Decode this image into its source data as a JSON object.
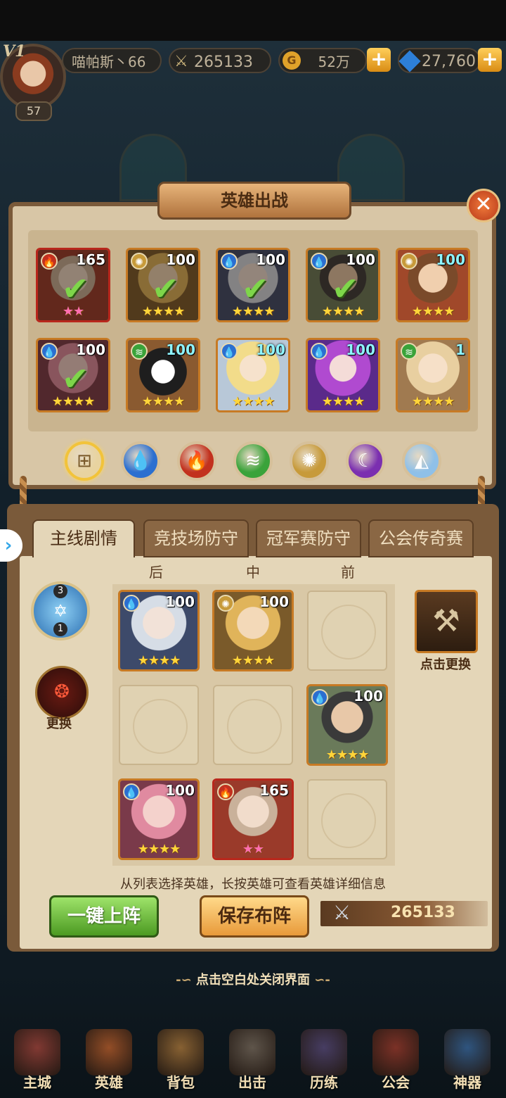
{
  "top_bar": {
    "vip_label": "V1",
    "player_level": "57",
    "player_name": "喵帕斯丶66",
    "combat_power": "265133",
    "gold": "52万",
    "gems": "27,760",
    "plus_symbol": "+",
    "coin_symbol": "G"
  },
  "panel_title": "英雄出战",
  "close_symbol": "✕",
  "hero_roster": [
    {
      "level": "165",
      "element": "fire",
      "stars": "★★",
      "star_color": "pink",
      "selected": true
    },
    {
      "level": "100",
      "element": "light",
      "stars": "★★★★",
      "selected": true
    },
    {
      "level": "100",
      "element": "water",
      "stars": "★★★★",
      "selected": true
    },
    {
      "level": "100",
      "element": "water",
      "stars": "★★★★",
      "selected": true
    },
    {
      "level": "100",
      "element": "light",
      "stars": "★★★★",
      "selected": false
    },
    {
      "level": "100",
      "element": "water",
      "stars": "★★★★",
      "selected": true
    },
    {
      "level": "100",
      "element": "wind",
      "stars": "★★★★",
      "selected": false
    },
    {
      "level": "100",
      "element": "water",
      "stars": "★★★★",
      "selected": false
    },
    {
      "level": "100",
      "element": "water",
      "stars": "★★★★",
      "selected": false
    },
    {
      "level": "1",
      "element": "wind",
      "stars": "★★★★",
      "selected": false
    }
  ],
  "check_symbol": "✔",
  "element_filters": [
    {
      "name": "all",
      "color": "#e8d3a0",
      "glyph": "⊞",
      "active": true
    },
    {
      "name": "water",
      "color": "#2b6fd0",
      "glyph": "💧",
      "active": false
    },
    {
      "name": "fire",
      "color": "#c2311e",
      "glyph": "🔥",
      "active": false
    },
    {
      "name": "wind",
      "color": "#3aa33a",
      "glyph": "≋",
      "active": false
    },
    {
      "name": "light",
      "color": "#c79a3a",
      "glyph": "✺",
      "active": false
    },
    {
      "name": "dark",
      "color": "#7b2fb0",
      "glyph": "☾",
      "active": false
    },
    {
      "name": "special",
      "color": "#8fc0e8",
      "glyph": "◭",
      "active": false
    }
  ],
  "tabs": [
    {
      "label": "主线剧情",
      "active": true
    },
    {
      "label": "竞技场防守",
      "active": false
    },
    {
      "label": "冠军赛防守",
      "active": false
    },
    {
      "label": "公会传奇赛",
      "active": false
    }
  ],
  "columns": {
    "back": "后",
    "middle": "中",
    "front": "前"
  },
  "formation": {
    "top_number": "3",
    "bottom_number": "1",
    "swap_label": "更换"
  },
  "artifact_label": "点击更换",
  "lineup": [
    {
      "level": "100",
      "element": "water",
      "stars": "★★★★"
    },
    {
      "level": "100",
      "element": "light",
      "stars": "★★★★"
    },
    {
      "level": "100",
      "element": "water",
      "stars": "★★★★"
    },
    {
      "level": "100",
      "element": "water",
      "stars": "★★★★"
    },
    {
      "level": "165",
      "element": "fire",
      "stars": "★★",
      "star_color": "pink"
    }
  ],
  "hint_text": "从列表选择英雄，长按英雄可查看英雄详细信息",
  "buttons": {
    "auto_deploy": "一键上阵",
    "save_lineup": "保存布阵"
  },
  "team_power": "265133",
  "close_hint": "点击空白处关闭界面",
  "close_hint_left": "-∽",
  "close_hint_right": "∽-",
  "bottom_nav": [
    {
      "label": "主城"
    },
    {
      "label": "英雄"
    },
    {
      "label": "背包"
    },
    {
      "label": "出击"
    },
    {
      "label": "历练"
    },
    {
      "label": "公会"
    },
    {
      "label": "神器"
    }
  ],
  "colors": {
    "water": "#2b6fd0",
    "fire": "#c2311e",
    "wind": "#3aa33a",
    "light": "#c79a3a",
    "dark": "#7b2fb0",
    "accent_gold": "#ffd53a"
  }
}
